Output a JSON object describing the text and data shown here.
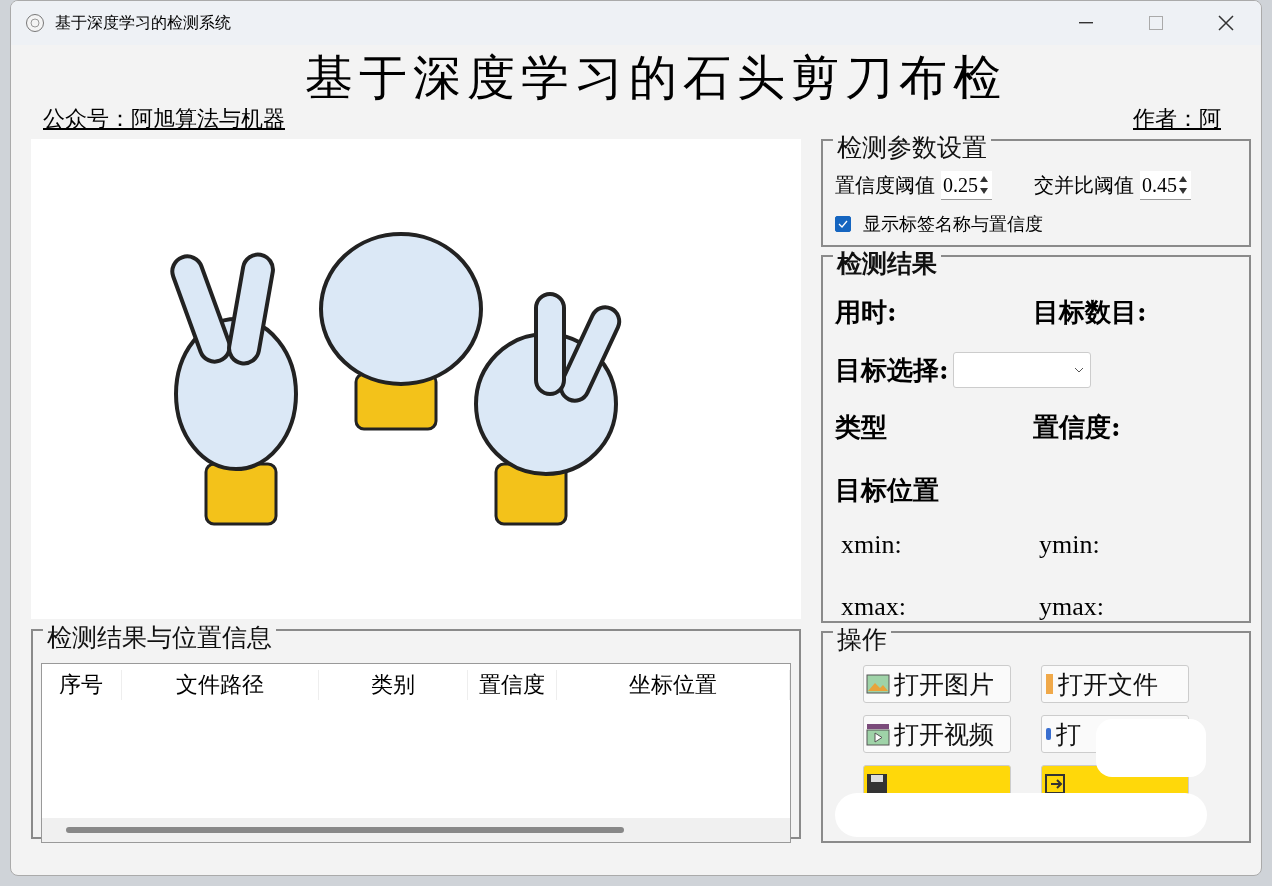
{
  "window": {
    "title": "基于深度学习的检测系统"
  },
  "header": {
    "title": "基于深度学习的石头剪刀布检",
    "left_text": "公众号：阿旭算法与机器",
    "right_text": "作者：阿"
  },
  "params": {
    "title": "检测参数设置",
    "confidence": {
      "label": "置信度阈值",
      "value": "0.25"
    },
    "iou": {
      "label": "交并比阈值",
      "value": "0.45"
    },
    "show_labels": {
      "label": "显示标签名称与置信度",
      "checked": true
    }
  },
  "results": {
    "title": "检测结果",
    "time_label": "用时:",
    "count_label": "目标数目:",
    "select_label": "目标选择:",
    "type_label": "类型",
    "confidence_label": "置信度:",
    "position_title": "目标位置",
    "xmin": "xmin:",
    "ymin": "ymin:",
    "xmax": "xmax:",
    "ymax": "ymax:"
  },
  "table": {
    "title": "检测结果与位置信息",
    "columns": [
      "序号",
      "文件路径",
      "类别",
      "置信度",
      "坐标位置"
    ]
  },
  "operations": {
    "title": "操作",
    "buttons": [
      {
        "kind": "image",
        "label": "打开图片"
      },
      {
        "kind": "file",
        "label": "打开文件"
      },
      {
        "kind": "video",
        "label": "打开视频"
      },
      {
        "kind": "camera",
        "label": "打"
      },
      {
        "kind": "save"
      },
      {
        "kind": "exit"
      }
    ]
  }
}
